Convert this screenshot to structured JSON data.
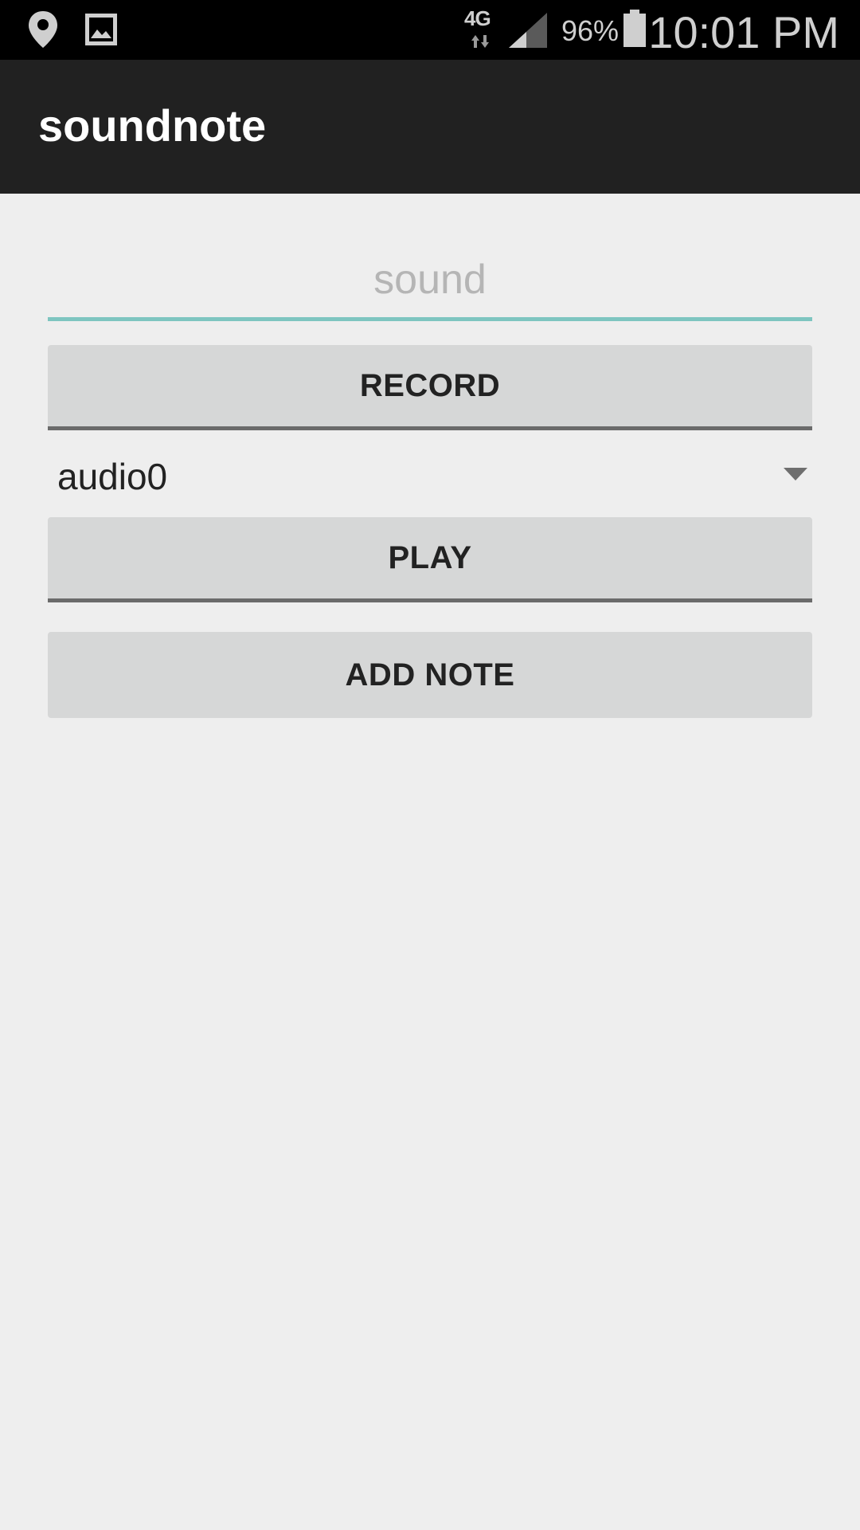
{
  "status_bar": {
    "network": "4G",
    "battery_percent": "96%",
    "time": "10:01 PM",
    "icons": [
      "location-icon",
      "gallery-icon",
      "network-arrows-icon",
      "signal-icon",
      "battery-icon"
    ]
  },
  "action_bar": {
    "title": "soundnote"
  },
  "form": {
    "sound_placeholder": "sound",
    "sound_value": "",
    "record_label": "RECORD",
    "spinner_selected": "audio0",
    "play_label": "PLAY",
    "add_note_label": "ADD NOTE"
  },
  "colors": {
    "action_bar_bg": "#212121",
    "status_bar_bg": "#000000",
    "accent_underline": "#7ec5c0",
    "button_bg": "#d6d7d7",
    "background": "#eeeeee"
  }
}
